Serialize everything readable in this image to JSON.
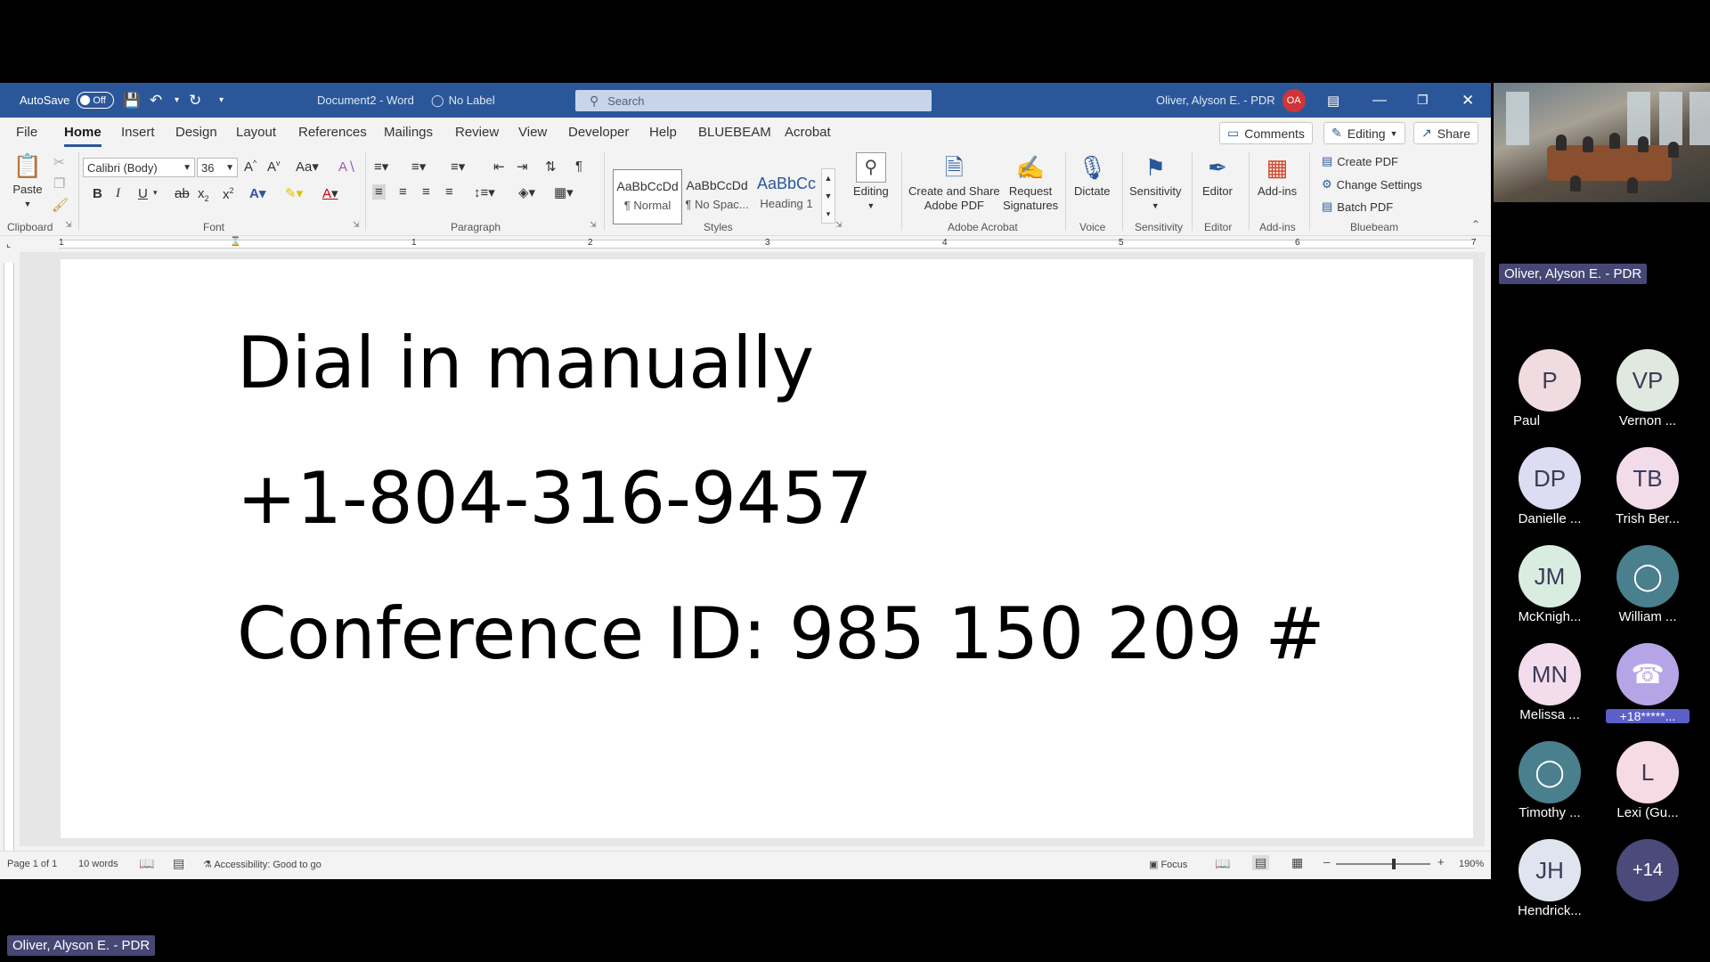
{
  "word": {
    "titlebar": {
      "autosave_label": "AutoSave",
      "autosave_state": "Off",
      "doc_title": "Document2 - Word",
      "label_status": "No Label",
      "search_placeholder": "Search",
      "user_name": "Oliver, Alyson E. - PDR",
      "user_initials": "OA"
    },
    "menu": {
      "tabs": [
        "File",
        "Home",
        "Insert",
        "Design",
        "Layout",
        "References",
        "Mailings",
        "Review",
        "View",
        "Developer",
        "Help",
        "BLUEBEAM",
        "Acrobat"
      ],
      "active": "Home",
      "comments_label": "Comments",
      "editing_label": "Editing",
      "share_label": "Share"
    },
    "ribbon": {
      "paste_label": "Paste",
      "font_name": "Calibri (Body)",
      "font_size": "36",
      "group_labels": {
        "clipboard": "Clipboard",
        "font": "Font",
        "paragraph": "Paragraph",
        "styles": "Styles",
        "adobe": "Adobe Acrobat",
        "voice": "Voice",
        "sensitivity": "Sensitivity",
        "editor": "Editor",
        "addins": "Add-ins",
        "bluebeam": "Bluebeam"
      },
      "styles": [
        {
          "sample": "AaBbCcDd",
          "name": "¶ Normal"
        },
        {
          "sample": "AaBbCcDd",
          "name": "¶ No Spac..."
        },
        {
          "sample": "AaBbCc",
          "name": "Heading 1"
        }
      ],
      "editing_btn": "Editing",
      "create_share_l1": "Create and Share",
      "create_share_l2": "Adobe PDF",
      "request_l1": "Request",
      "request_l2": "Signatures",
      "dictate": "Dictate",
      "sensitivity": "Sensitivity",
      "editor": "Editor",
      "addins": "Add-ins",
      "bluebeam_items": [
        "Create PDF",
        "Change Settings",
        "Batch PDF"
      ]
    },
    "ruler_numbers": [
      "1",
      "1",
      "2",
      "3",
      "4",
      "5",
      "6",
      "7"
    ],
    "document_lines": [
      "Dial in manually",
      "+1-804-316-9457",
      "Conference ID: 985 150 209 #"
    ],
    "status": {
      "page": "Page 1 of 1",
      "words": "10 words",
      "accessibility": "Accessibility: Good to go",
      "focus": "Focus",
      "zoom": "190%"
    }
  },
  "teams": {
    "presenter_tag": "Oliver, Alyson E. - PDR",
    "bottom_tag": "Oliver, Alyson E. - PDR",
    "participants": [
      {
        "initials": "P",
        "name": "Paul",
        "color": "#f0dce0"
      },
      {
        "initials": "VP",
        "name": "Vernon ...",
        "color": "#dfe9df"
      },
      {
        "initials": "DP",
        "name": "Danielle ...",
        "color": "#dcdcf3"
      },
      {
        "initials": "TB",
        "name": "Trish Ber...",
        "color": "#f3dce9"
      },
      {
        "initials": "JM",
        "name": "McKnigh...",
        "color": "#d9ece0"
      },
      {
        "initials": "",
        "name": "William ...",
        "color": "#4a7f8e",
        "icon": "person-icon"
      },
      {
        "initials": "MN",
        "name": "Melissa ...",
        "color": "#f3dceb"
      },
      {
        "initials": "",
        "name": "+18*****...",
        "color": "#b6a5e6",
        "icon": "phone-person-icon"
      },
      {
        "initials": "",
        "name": "Timothy ...",
        "color": "#4a7f8e",
        "icon": "person-icon"
      },
      {
        "initials": "L",
        "name": "Lexi (Gu...",
        "color": "#f6dbe4"
      },
      {
        "initials": "JH",
        "name": "Hendrick...",
        "color": "#dfe4ee"
      },
      {
        "initials": "+14",
        "name": "",
        "color": "#4b4a7a"
      }
    ]
  }
}
